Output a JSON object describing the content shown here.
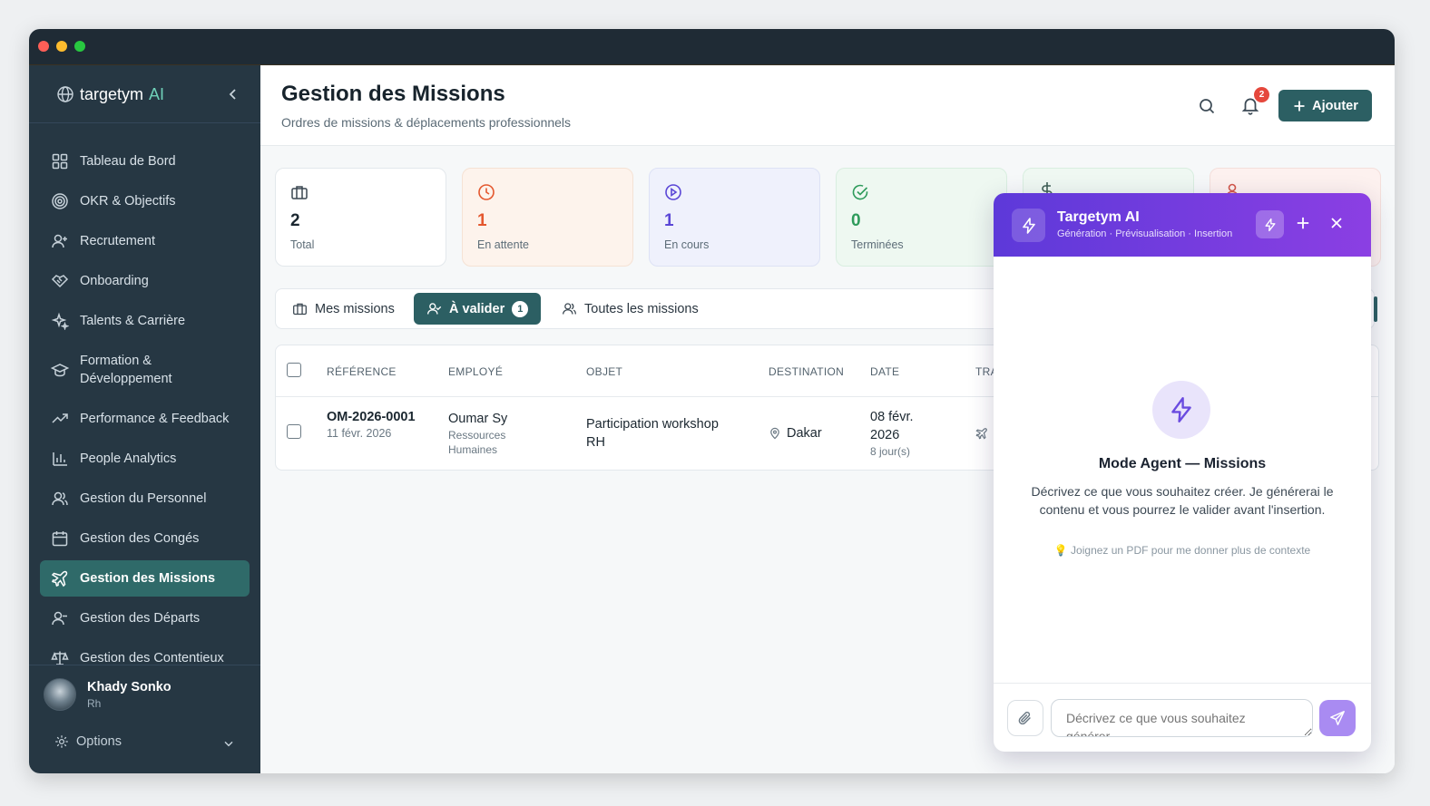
{
  "app": {
    "brand": "targetym",
    "brand_ai": "AI"
  },
  "sidebar": {
    "items": [
      {
        "label": "Tableau de Bord",
        "icon": "dashboard-icon"
      },
      {
        "label": "OKR & Objectifs",
        "icon": "target-icon"
      },
      {
        "label": "Recrutement",
        "icon": "user-plus-icon"
      },
      {
        "label": "Onboarding",
        "icon": "handshake-icon"
      },
      {
        "label": "Talents & Carrière",
        "icon": "sparkles-icon"
      },
      {
        "label": "Formation & Développement",
        "icon": "graduation-cap-icon"
      },
      {
        "label": "Performance & Feedback",
        "icon": "trending-up-icon"
      },
      {
        "label": "People Analytics",
        "icon": "bar-chart-icon"
      },
      {
        "label": "Gestion du Personnel",
        "icon": "users-icon"
      },
      {
        "label": "Gestion des Congés",
        "icon": "calendar-icon"
      },
      {
        "label": "Gestion des Missions",
        "icon": "plane-icon",
        "active": true
      },
      {
        "label": "Gestion des Départs",
        "icon": "user-minus-icon"
      },
      {
        "label": "Gestion des Contentieux",
        "icon": "scale-icon"
      }
    ],
    "user": {
      "name": "Khady Sonko",
      "role": "Rh"
    },
    "options_label": "Options"
  },
  "header": {
    "title": "Gestion des Missions",
    "subtitle": "Ordres de missions & déplacements professionnels",
    "notification_count": "2",
    "add_label": "Ajouter"
  },
  "stats": [
    {
      "value": "2",
      "label": "Total",
      "color": "#1b2730",
      "bg": "#ffffff",
      "icon": "briefcase-icon"
    },
    {
      "value": "1",
      "label": "En attente",
      "color": "#e4572e",
      "bg": "#fdf3ec",
      "icon": "clock-icon"
    },
    {
      "value": "1",
      "label": "En cours",
      "color": "#5a46d6",
      "bg": "#eff1fc",
      "icon": "play-circle-icon"
    },
    {
      "value": "0",
      "label": "Terminées",
      "color": "#2e9b5b",
      "bg": "#eef8f1",
      "icon": "check-circle-icon"
    }
  ],
  "tabs": [
    {
      "label": "Mes missions",
      "icon": "briefcase-icon"
    },
    {
      "label": "À valider",
      "icon": "user-check-icon",
      "count": "1",
      "active": true
    },
    {
      "label": "Toutes les missions",
      "icon": "users-icon"
    }
  ],
  "table": {
    "columns": [
      "RÉFÉRENCE",
      "EMPLOYÉ",
      "OBJET",
      "DESTINATION",
      "DATE",
      "TRA"
    ],
    "rows": [
      {
        "reference": "OM-2026-0001",
        "reference_date": "11 févr. 2026",
        "employee": "Oumar Sy",
        "department": "Ressources Humaines",
        "object": "Participation workshop RH",
        "destination": "Dakar",
        "date": "08 févr. 2026",
        "duration": "8 jour(s)"
      }
    ]
  },
  "ai_panel": {
    "title": "Targetym AI",
    "subtitle": "Génération · Prévisualisation · Insertion",
    "mode_title": "Mode Agent — Missions",
    "description": "Décrivez ce que vous souhaitez créer. Je générerai le contenu et vous pourrez le valider avant l'insertion.",
    "hint": "💡 Joignez un PDF pour me donner plus de contexte",
    "input_placeholder": "Décrivez ce que vous souhaitez générer..."
  }
}
